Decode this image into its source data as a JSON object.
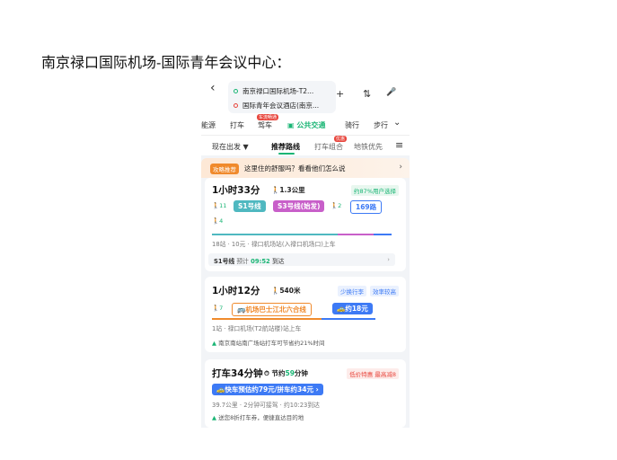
{
  "document": {
    "title": "南京禄口国际机场-国际青年会议中心："
  },
  "topbar": {
    "origin": "南京禄口国际机场-T2...",
    "destination": "国际青年会议酒店(南京...",
    "add": "+",
    "swap": "⇅",
    "voice": "🎤",
    "back": "‹"
  },
  "tabs": {
    "items": [
      "能源",
      "打车",
      "驾车",
      "公共交通",
      "骑行",
      "步行"
    ],
    "drive_tag": "车流畅通",
    "more": "⌄"
  },
  "filters": {
    "depart": "现在出发 ▼",
    "recommend": "推荐路线",
    "taxi_combo": "打车组合",
    "subway": "地铁优先",
    "taxi_tag": "优惠",
    "menu": "≡"
  },
  "banner": {
    "badge": "攻略推荐",
    "text": "这里住的舒服吗？看看他们怎么说",
    "arrow": "›"
  },
  "route1": {
    "time": "1小时33分",
    "walk": "1.3公里",
    "badge": "约87%用户选择",
    "walk_a": "11",
    "line1": "S1号线",
    "line2": "S3号线(始发)",
    "walk_b": "2",
    "line3": "169路",
    "walk_c": "4",
    "info": "18站 · 10元 · 禄口机场站(入禄口机场口)上车",
    "arrive_line": "S1号线",
    "arrive_label": "预计",
    "arrive_time": "09:52",
    "arrive_suffix": "到达",
    "arrive_arrow": "›"
  },
  "route2": {
    "time": "1小时12分",
    "walk": "540米",
    "badge_a": "少换行李",
    "badge_b": "效率较高",
    "walk_a": "7",
    "bus": "机场巴士江北六合线",
    "taxi": "约18元",
    "info": "1站 · 禄口机场(T2航站楼)站上车",
    "note": "南京南站南广场站打车可节省约21%时间"
  },
  "route3": {
    "time": "打车34分钟",
    "save": "节约",
    "save_value": "59",
    "save_unit": "分钟",
    "badge": "低价特惠 最高减8",
    "taxi_cta": "快车预估约79元/拼车约34元 ›",
    "info": "39.7公里 · 2分钟可接驾 · 约10:23到达",
    "note": "送您8折打车券，便捷直达目的地"
  },
  "colors": {
    "accent": "#19b574",
    "blue": "#3d7af5",
    "purple": "#c85fc9",
    "teal": "#4fb8c0",
    "orange": "#f08a2c",
    "red": "#e8453c"
  }
}
